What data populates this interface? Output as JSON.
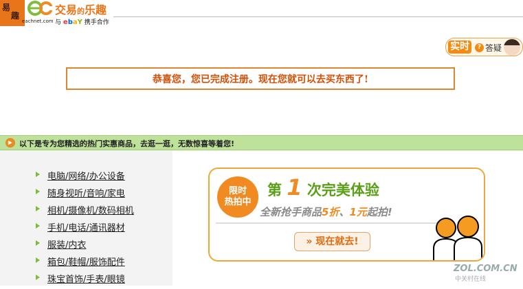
{
  "header": {
    "logo_glyph_1": "易",
    "logo_glyph_2": "趣",
    "domain": "eachnet.com",
    "slogan_main": "交易",
    "slogan_small": "的",
    "slogan_end": "乐趣",
    "partner_and": "与",
    "partner_brand": "ebay",
    "partner_text": "携手合作"
  },
  "help": {
    "live_label": "实时",
    "q_mark": "?",
    "ask_label": "答疑"
  },
  "notice": {
    "text": "恭喜您，您已完成注册。现在您就可以去买东西了!"
  },
  "promo": {
    "text": "以下是专为您精选的热门实惠商品，去逛一逛，无数惊喜等着您!"
  },
  "categories": [
    "电脑/网络/办公设备",
    "随身视听/音响/家电",
    "相机/摄像机/数码相机",
    "手机/电话/通讯器材",
    "服装/内衣",
    "箱包/鞋帽/服饰配件",
    "珠宝首饰/手表/眼镜"
  ],
  "banner": {
    "badge_line1": "限时",
    "badge_line2": "热拍中",
    "title_pre": "第",
    "title_num": "1",
    "title_post": "次完美体验",
    "sub_1": "全新抢手商品",
    "sub_2": "5折",
    "sub_3": "、",
    "sub_4": "1元",
    "sub_5": "起拍!",
    "button": "现在就去!"
  },
  "watermark": {
    "main": "ZOL.COM.CN",
    "sub": "中关村在线"
  },
  "colors": {
    "accent_orange": "#e8751a",
    "promo_green": "#bfe29a",
    "title_green": "#5a9f17"
  }
}
